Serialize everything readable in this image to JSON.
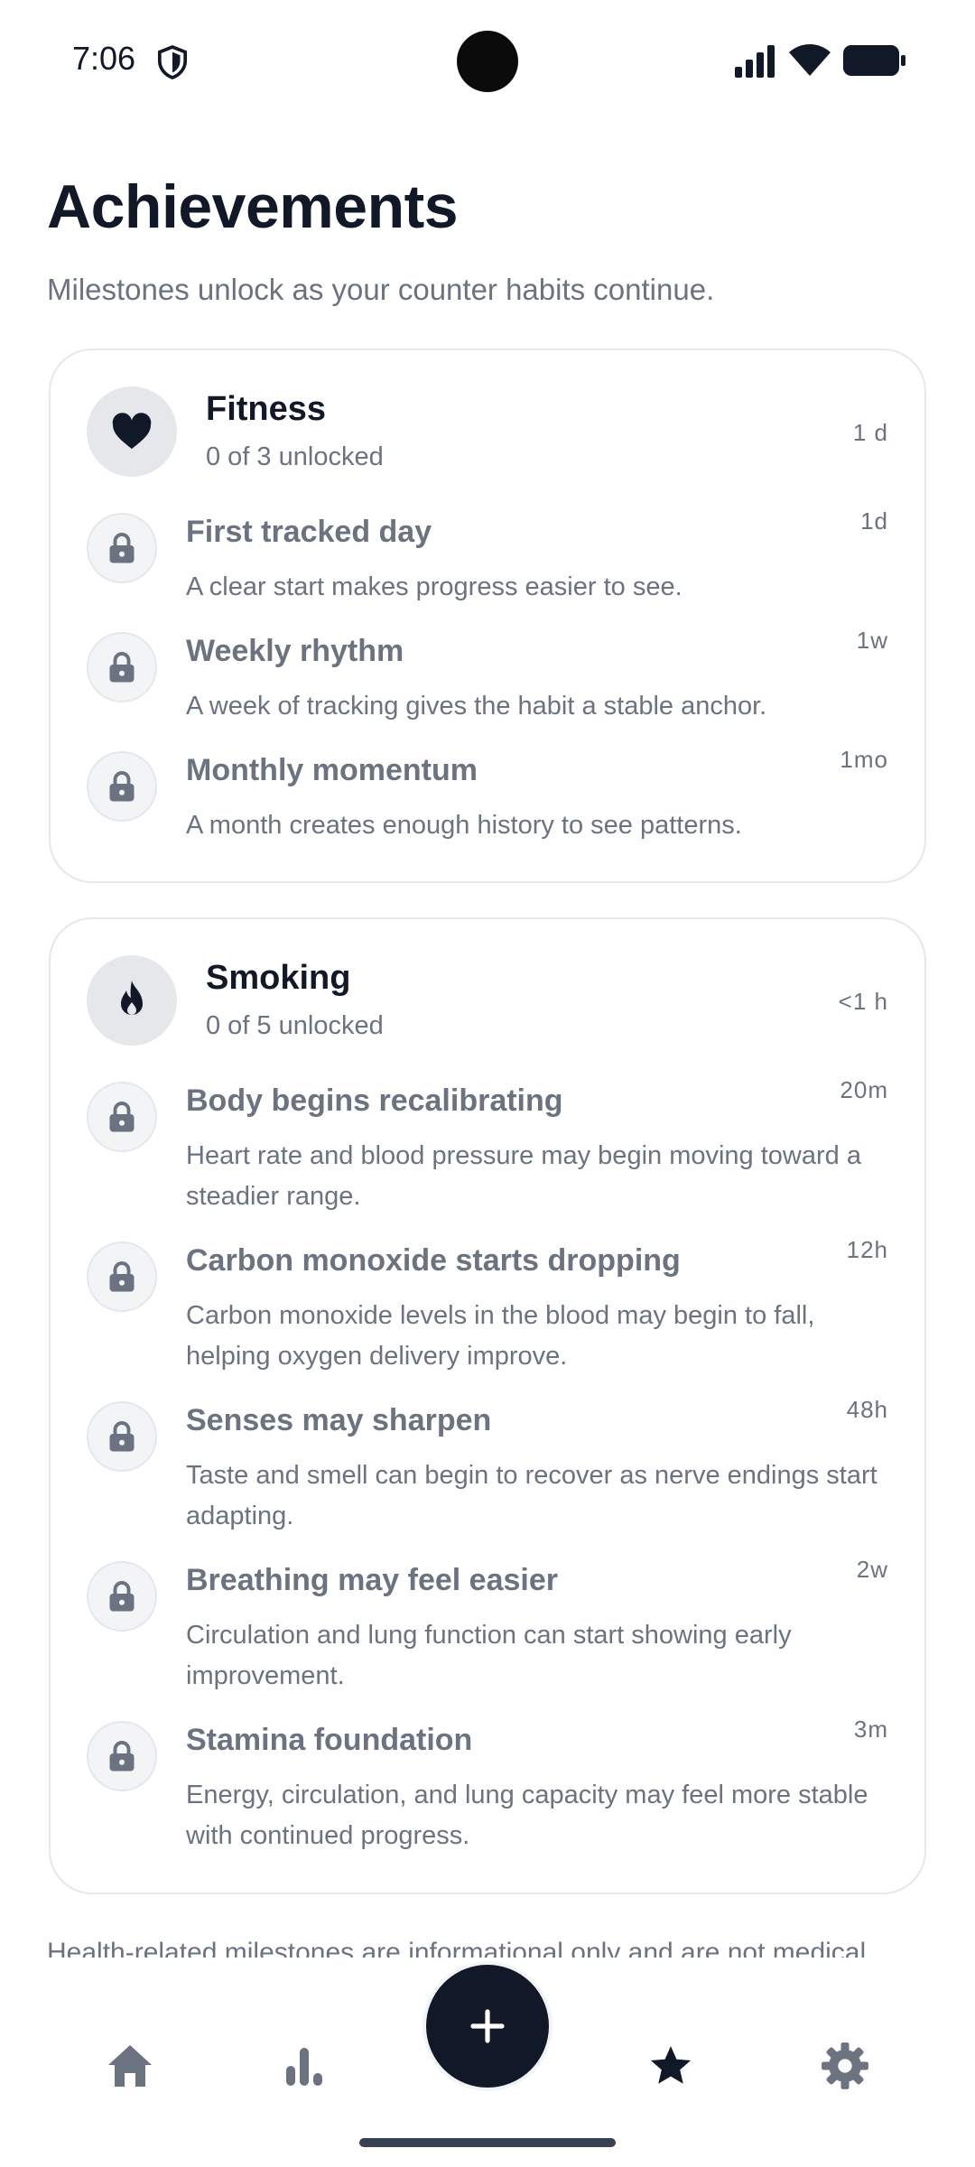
{
  "status_bar": {
    "time": "7:06"
  },
  "header": {
    "title": "Achievements",
    "subtitle": "Milestones unlock as your counter habits continue."
  },
  "categories": [
    {
      "name": "Fitness",
      "icon": "heart-icon",
      "unlocked": "0 of 3 unlocked",
      "time": "1 d",
      "achievements": [
        {
          "title": "First tracked day",
          "desc": "A clear start makes progress easier to see.",
          "time": "1d"
        },
        {
          "title": "Weekly rhythm",
          "desc": "A week of tracking gives the habit a stable anchor.",
          "time": "1w"
        },
        {
          "title": "Monthly momentum",
          "desc": "A month creates enough history to see patterns.",
          "time": "1mo"
        }
      ]
    },
    {
      "name": "Smoking",
      "icon": "flame-icon",
      "unlocked": "0 of 5 unlocked",
      "time": "<1 h",
      "achievements": [
        {
          "title": "Body begins recalibrating",
          "desc": "Heart rate and blood pressure may begin moving toward a steadier range.",
          "time": "20m"
        },
        {
          "title": "Carbon monoxide starts dropping",
          "desc": "Carbon monoxide levels in the blood may begin to fall, helping oxygen delivery improve.",
          "time": "12h"
        },
        {
          "title": "Senses may sharpen",
          "desc": "Taste and smell can begin to recover as nerve endings start adapting.",
          "time": "48h"
        },
        {
          "title": "Breathing may feel easier",
          "desc": "Circulation and lung function can start showing early improvement.",
          "time": "2w"
        },
        {
          "title": "Stamina foundation",
          "desc": "Energy, circulation, and lung capacity may feel more stable with continued progress.",
          "time": "3m"
        }
      ]
    }
  ],
  "disclaimer": "Health-related milestones are informational only and are not medical",
  "nav": {
    "items": [
      "home",
      "stats",
      "add",
      "achievements",
      "settings"
    ],
    "active": "achievements",
    "active_color": "#111827",
    "inactive_color": "#6b7280"
  }
}
